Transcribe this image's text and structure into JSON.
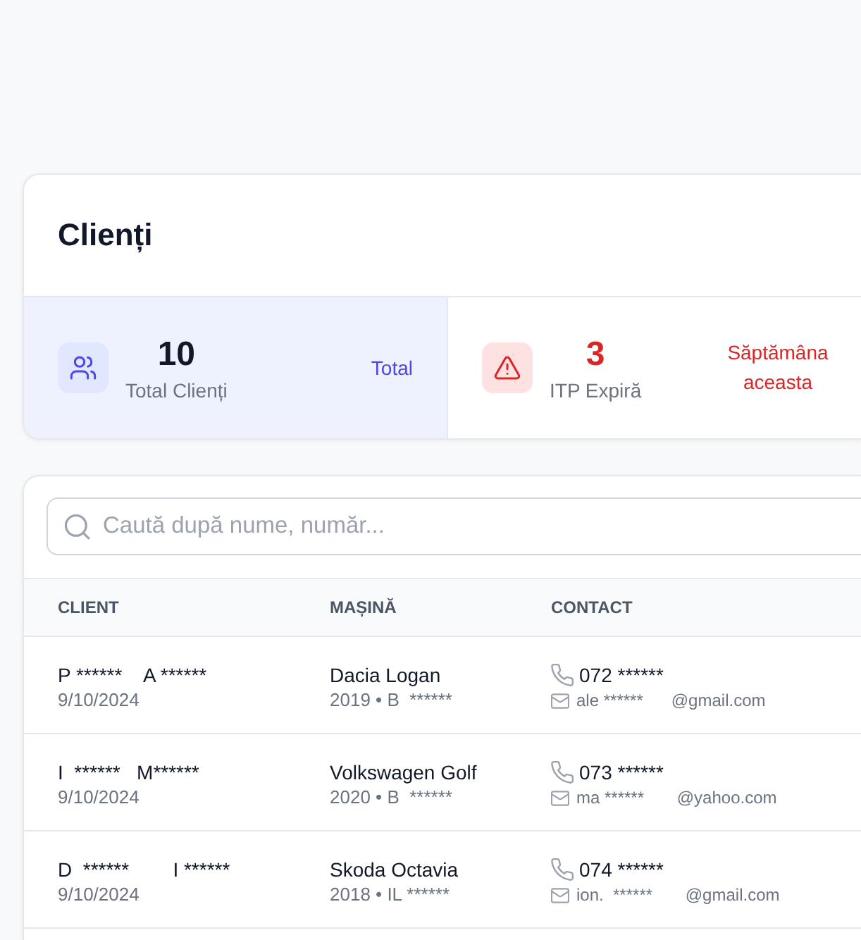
{
  "page": {
    "title": "Clienți"
  },
  "stats": [
    {
      "kind": "clients",
      "selected": true,
      "value": "10",
      "label": "Total Clienți",
      "note": "Total"
    },
    {
      "kind": "itp_expiring",
      "selected": false,
      "value": "3",
      "label": "ITP Expiră",
      "note": "Săptămâna aceasta"
    }
  ],
  "search": {
    "placeholder": "Caută după nume, număr..."
  },
  "table": {
    "columns": [
      "CLIENT",
      "MAȘINĂ",
      "CONTACT"
    ],
    "rows": [
      {
        "client": "P ******    A ******",
        "date": "9/10/2024",
        "car": "Dacia Logan",
        "car_details": "2019 • B  ******",
        "phone": "072 ******",
        "email": "ale ******      @gmail.com"
      },
      {
        "client": "I  ******   M******",
        "date": "9/10/2024",
        "car": "Volkswagen Golf",
        "car_details": "2020 • B  ******",
        "phone": "073 ******",
        "email": "ma ******       @yahoo.com"
      },
      {
        "client": "D  ******        I ******",
        "date": "9/10/2024",
        "car": "Skoda Octavia",
        "car_details": "2018 • IL ******",
        "phone": "074 ******",
        "email": "ion.  ******       @gmail.com"
      }
    ]
  }
}
